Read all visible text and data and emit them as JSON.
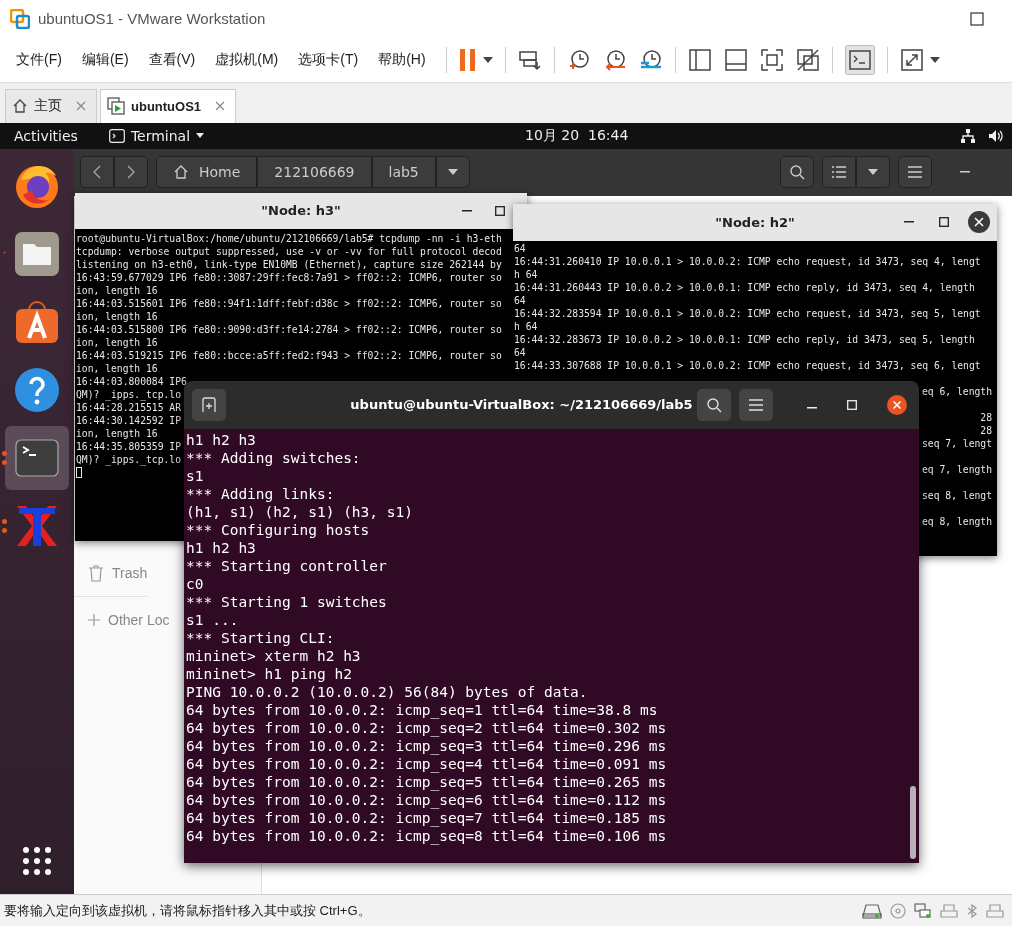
{
  "window": {
    "title": "ubuntuOS1 - VMware Workstation"
  },
  "menu": [
    "文件(F)",
    "编辑(E)",
    "查看(V)",
    "虚拟机(M)",
    "选项卡(T)",
    "帮助(H)"
  ],
  "tabs": [
    {
      "label": "主页",
      "kind": "home",
      "selected": false
    },
    {
      "label": "ubuntuOS1",
      "kind": "vm",
      "selected": true
    }
  ],
  "gnome_bar": {
    "activities": "Activities",
    "app": "Terminal",
    "clock": "10月 20  16:44"
  },
  "dock": [
    {
      "kind": "firefox",
      "running": false,
      "multi_window": false,
      "active": false
    },
    {
      "kind": "files",
      "running": true,
      "multi_window": false,
      "active": false
    },
    {
      "kind": "software",
      "running": false,
      "multi_window": false,
      "active": false
    },
    {
      "kind": "help",
      "running": false,
      "multi_window": false,
      "active": false
    },
    {
      "kind": "terminal",
      "running": true,
      "multi_window": true,
      "active": true
    },
    {
      "kind": "xterm",
      "running": true,
      "multi_window": true,
      "active": false
    }
  ],
  "files": {
    "path": [
      "Home",
      "212106669",
      "lab5"
    ],
    "sidebar": [
      {
        "kind": "trash",
        "label": "Trash"
      },
      {
        "kind": "other",
        "label": "Other Loc"
      }
    ]
  },
  "xterm_h3": {
    "title": "\"Node: h3\"",
    "lines": [
      "root@ubuntu-VirtualBox:/home/ubuntu/212106669/lab5# tcpdump -nn -i h3-eth",
      "tcpdump: verbose output suppressed, use -v or -vv for full protocol decod",
      "listening on h3-eth0, link-type EN10MB (Ethernet), capture size 262144 by",
      "16:43:59.677029 IP6 fe80::3087:29ff:fec8:7a91 > ff02::2: ICMP6, router so",
      "ion, length 16",
      "16:44:03.515601 IP6 fe80::94f1:1dff:febf:d38c > ff02::2: ICMP6, router so",
      "ion, length 16",
      "16:44:03.515800 IP6 fe80::9090:d3ff:fe14:2784 > ff02::2: ICMP6, router so",
      "ion, length 16",
      "16:44:03.519215 IP6 fe80::bcce:a5ff:fed2:f943 > ff02::2: ICMP6, router so",
      "ion, length 16",
      "16:44:03.800084 IP6",
      "QM)? _ipps._tcp.lo",
      "16:44:28.215515 AR",
      "16:44:30.142592 IP",
      "ion, length 16",
      "16:44:35.805359 IP",
      "QM)? _ipps._tcp.lo"
    ]
  },
  "xterm_h2": {
    "title": "\"Node: h2\"",
    "rows": [
      {
        "kind": "full",
        "text": "64"
      },
      {
        "kind": "full",
        "text": "16:44:31.260410 IP 10.0.0.1 > 10.0.0.2: ICMP echo request, id 3473, seq 4, lengt"
      },
      {
        "kind": "full",
        "text": "h 64"
      },
      {
        "kind": "full",
        "text": "16:44:31.260443 IP 10.0.0.2 > 10.0.0.1: ICMP echo reply, id 3473, seq 4, length"
      },
      {
        "kind": "full",
        "text": "64"
      },
      {
        "kind": "full",
        "text": "16:44:32.283594 IP 10.0.0.1 > 10.0.0.2: ICMP echo request, id 3473, seq 5, lengt"
      },
      {
        "kind": "full",
        "text": "h 64"
      },
      {
        "kind": "full",
        "text": "16:44:32.283673 IP 10.0.0.2 > 10.0.0.1: ICMP echo reply, id 3473, seq 5, length"
      },
      {
        "kind": "full",
        "text": "64"
      },
      {
        "kind": "full",
        "text": "16:44:33.307688 IP 10.0.0.1 > 10.0.0.2: ICMP echo request, id 3473, seq 6, lengt"
      },
      {
        "kind": "gap"
      },
      {
        "kind": "tail",
        "text": "eq 6, length"
      },
      {
        "kind": "gap"
      },
      {
        "kind": "tail",
        "text": "28"
      },
      {
        "kind": "tail",
        "text": "28"
      },
      {
        "kind": "tail",
        "text": "seq 7, lengt"
      },
      {
        "kind": "gap"
      },
      {
        "kind": "tail",
        "text": "eq 7, length"
      },
      {
        "kind": "gap"
      },
      {
        "kind": "tail",
        "text": "seq 8, lengt"
      },
      {
        "kind": "gap"
      },
      {
        "kind": "tail",
        "text": "eq 8, length"
      }
    ]
  },
  "terminal": {
    "title": "ubuntu@ubuntu-VirtualBox: ~/212106669/lab5",
    "lines": [
      "h1 h2 h3",
      "*** Adding switches:",
      "s1",
      "*** Adding links:",
      "(h1, s1) (h2, s1) (h3, s1)",
      "*** Configuring hosts",
      "h1 h2 h3",
      "*** Starting controller",
      "c0",
      "*** Starting 1 switches",
      "s1 ...",
      "*** Starting CLI:",
      "mininet> xterm h2 h3",
      "mininet> h1 ping h2",
      "PING 10.0.0.2 (10.0.0.2) 56(84) bytes of data.",
      "64 bytes from 10.0.0.2: icmp_seq=1 ttl=64 time=38.8 ms",
      "64 bytes from 10.0.0.2: icmp_seq=2 ttl=64 time=0.302 ms",
      "64 bytes from 10.0.0.2: icmp_seq=3 ttl=64 time=0.296 ms",
      "64 bytes from 10.0.0.2: icmp_seq=4 ttl=64 time=0.091 ms",
      "64 bytes from 10.0.0.2: icmp_seq=5 ttl=64 time=0.265 ms",
      "64 bytes from 10.0.0.2: icmp_seq=6 ttl=64 time=0.112 ms",
      "64 bytes from 10.0.0.2: icmp_seq=7 ttl=64 time=0.185 ms",
      "64 bytes from 10.0.0.2: icmp_seq=8 ttl=64 time=0.106 ms"
    ]
  },
  "status_bar": {
    "text": "要将输入定向到该虚拟机，请将鼠标指针移入其中或按 Ctrl+G。"
  }
}
